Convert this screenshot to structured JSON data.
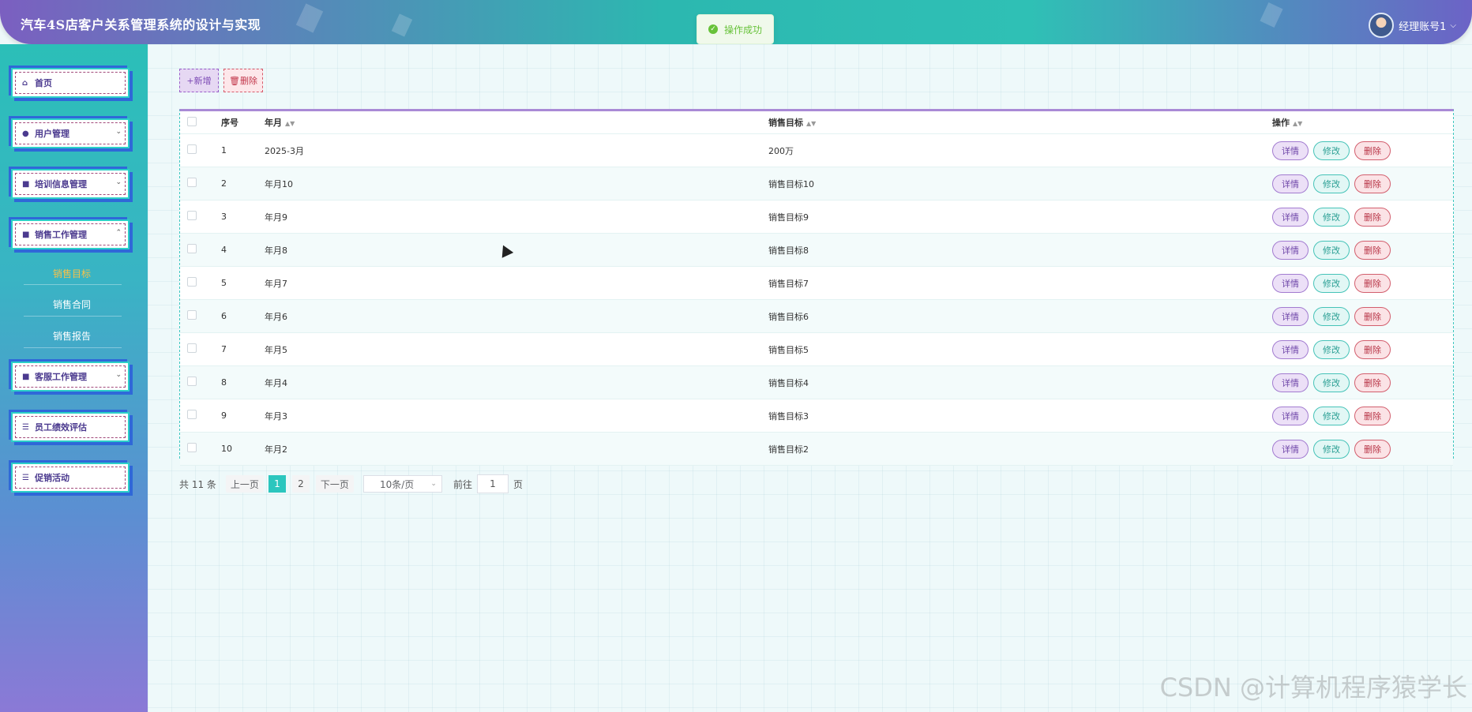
{
  "header": {
    "title": "汽车4S店客户关系管理系统的设计与实现",
    "user_name": "经理账号1",
    "toast": "操作成功"
  },
  "sidebar": {
    "items": [
      {
        "label": "首页",
        "icon": "home-icon",
        "has_chevron": false
      },
      {
        "label": "用户管理",
        "icon": "user-icon",
        "has_chevron": true
      },
      {
        "label": "培训信息管理",
        "icon": "folder-icon",
        "has_chevron": true
      },
      {
        "label": "销售工作管理",
        "icon": "folder-icon",
        "has_chevron": true,
        "expanded": true
      },
      {
        "label": "客服工作管理",
        "icon": "folder-icon",
        "has_chevron": true
      },
      {
        "label": "员工绩效评估",
        "icon": "list-icon",
        "has_chevron": false
      },
      {
        "label": "促销活动",
        "icon": "list-icon",
        "has_chevron": false
      }
    ],
    "sub_items": [
      "销售目标",
      "销售合同",
      "销售报告"
    ],
    "active_sub": "销售目标"
  },
  "toolbar": {
    "add_label": "新增",
    "delete_label": "删除"
  },
  "table": {
    "columns": [
      "序号",
      "年月",
      "销售目标",
      "操作"
    ],
    "rows": [
      {
        "index": "1",
        "month": "2025-3月",
        "target": "200万"
      },
      {
        "index": "2",
        "month": "年月10",
        "target": "销售目标10"
      },
      {
        "index": "3",
        "month": "年月9",
        "target": "销售目标9"
      },
      {
        "index": "4",
        "month": "年月8",
        "target": "销售目标8"
      },
      {
        "index": "5",
        "month": "年月7",
        "target": "销售目标7"
      },
      {
        "index": "6",
        "month": "年月6",
        "target": "销售目标6"
      },
      {
        "index": "7",
        "month": "年月5",
        "target": "销售目标5"
      },
      {
        "index": "8",
        "month": "年月4",
        "target": "销售目标4"
      },
      {
        "index": "9",
        "month": "年月3",
        "target": "销售目标3"
      },
      {
        "index": "10",
        "month": "年月2",
        "target": "销售目标2"
      }
    ],
    "actions": {
      "detail": "详情",
      "edit": "修改",
      "delete": "删除"
    }
  },
  "pagination": {
    "total": "共 11 条",
    "prev": "上一页",
    "pages": [
      "1",
      "2"
    ],
    "current": "1",
    "next": "下一页",
    "page_size": "10条/页",
    "goto_label": "前往",
    "goto_value": "1",
    "page_unit": "页"
  },
  "watermark": "CSDN @计算机程序猿学长",
  "colors": {
    "accent": "#2bc6be",
    "active_sub": "#f7c14a"
  }
}
